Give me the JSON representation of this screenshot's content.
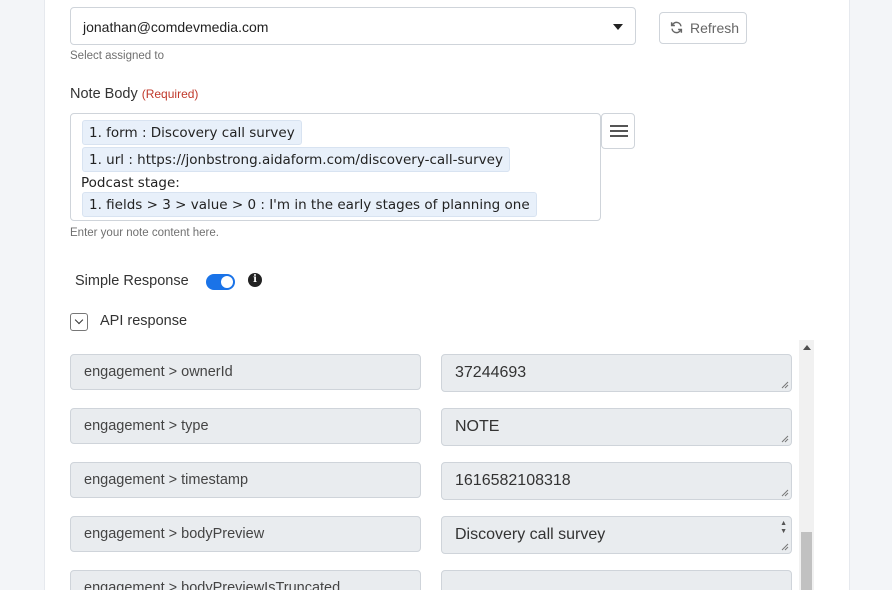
{
  "assigned_to": {
    "value": "jonathan@comdevmedia.com",
    "help": "Select assigned to",
    "refresh_label": "Refresh"
  },
  "note_body": {
    "label": "Note Body",
    "required": "(Required)",
    "lines": [
      "1. form : Discovery call survey",
      "1. url : https://jonbstrong.aidaform.com/discovery-call-survey",
      "Podcast stage:",
      "1. fields > 3 > value > 0 : I'm in the early stages of planning one"
    ],
    "help": "Enter your note content here."
  },
  "simple_response": {
    "label": "Simple Response",
    "enabled": true,
    "info_glyph": "i"
  },
  "api_response": {
    "label": "API response",
    "rows": [
      {
        "key": "engagement > ownerId",
        "value": "37244693"
      },
      {
        "key": "engagement > type",
        "value": "NOTE"
      },
      {
        "key": "engagement > timestamp",
        "value": "1616582108318"
      },
      {
        "key": "engagement > bodyPreview",
        "value": "Discovery call survey"
      },
      {
        "key": "engagement > bodyPreviewIsTruncated",
        "value": ""
      }
    ]
  },
  "colors": {
    "accent": "#1a73e8",
    "required": "#c0392b",
    "chip_bg": "#e8f0fa",
    "readonly_bg": "#e9ecef"
  },
  "icons": [
    "chevron-down-icon",
    "refresh-icon",
    "hamburger-menu-icon",
    "info-icon",
    "collapse-chevron-icon",
    "resize-grip-icon",
    "scroll-up-icon"
  ]
}
